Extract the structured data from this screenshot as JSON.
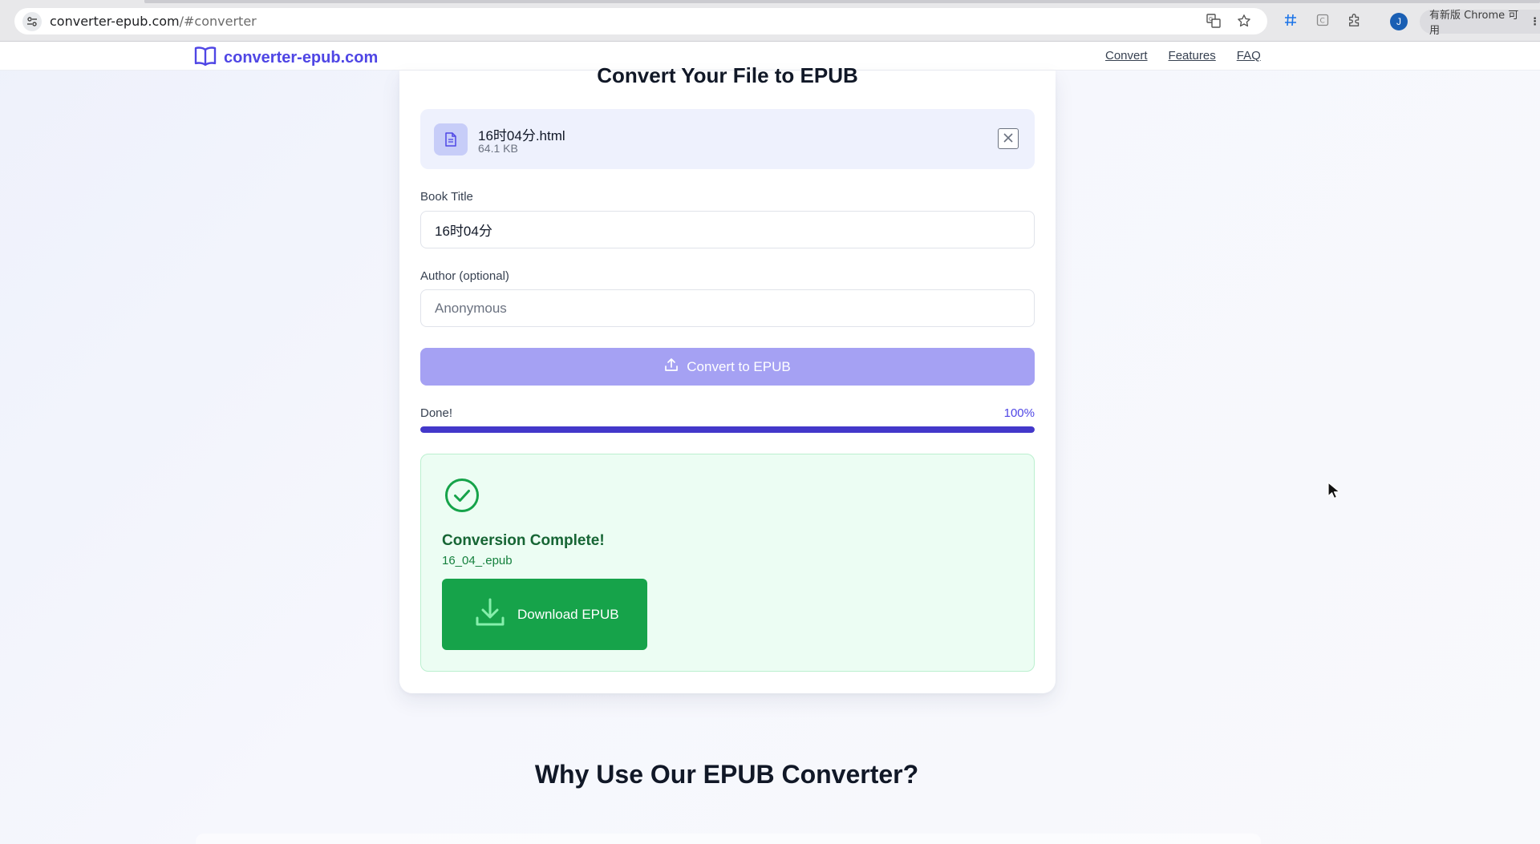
{
  "browser": {
    "url_host": "converter-epub.com",
    "url_path": "/#converter",
    "profile_initial": "J",
    "update_label": "有新版 Chrome 可用"
  },
  "header": {
    "brand": "converter-epub.com",
    "nav": [
      "Convert",
      "Features",
      "FAQ"
    ]
  },
  "converter": {
    "title": "Convert Your File to EPUB",
    "file": {
      "name": "16时04分.html",
      "size": "64.1 KB"
    },
    "book_title_label": "Book Title",
    "book_title_value": "16时04分",
    "author_label": "Author (optional)",
    "author_placeholder": "Anonymous",
    "convert_label": "Convert to EPUB",
    "progress": {
      "status": "Done!",
      "percent_label": "100%",
      "fraction": 1.0
    },
    "result": {
      "title": "Conversion Complete!",
      "filename": "16_04_.epub",
      "download_label": "Download EPUB"
    }
  },
  "features": {
    "heading": "Why Use Our EPUB Converter?"
  },
  "colors": {
    "brand": "#4f46e5",
    "convert_button": "#a5a1f3",
    "progress": "#4338ca",
    "success": "#16a34a"
  }
}
